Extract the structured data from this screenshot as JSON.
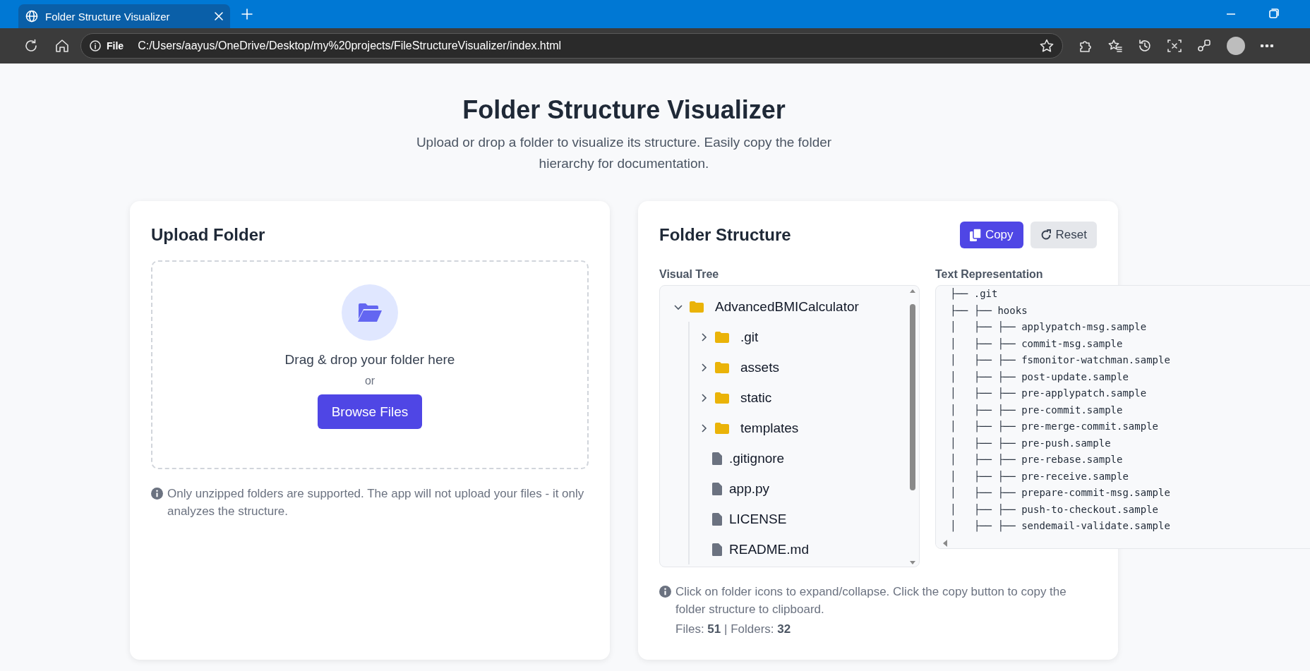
{
  "browser": {
    "tab_title": "Folder Structure Visualizer",
    "scheme_label": "File",
    "url": "C:/Users/aayus/OneDrive/Desktop/my%20projects/FileStructureVisualizer/index.html"
  },
  "header": {
    "title": "Folder Structure Visualizer",
    "subtitle": "Upload or drop a folder to visualize its structure. Easily copy the folder hierarchy for documentation."
  },
  "upload": {
    "title": "Upload Folder",
    "drop_text": "Drag & drop your folder here",
    "or_text": "or",
    "browse_button": "Browse Files",
    "note": "Only unzipped folders are supported. The app will not upload your files - it only analyzes the structure."
  },
  "structure": {
    "title": "Folder Structure",
    "buttons": [
      {
        "label": "Copy",
        "kind": "primary"
      },
      {
        "label": "Reset",
        "kind": "secondary"
      }
    ],
    "visual_tree_label": "Visual Tree",
    "tree": {
      "name": "AdvancedBMICalculator",
      "kind": "folder",
      "expanded": true,
      "children": [
        {
          "name": ".git",
          "kind": "folder",
          "expanded": false
        },
        {
          "name": "assets",
          "kind": "folder",
          "expanded": false
        },
        {
          "name": "static",
          "kind": "folder",
          "expanded": false
        },
        {
          "name": "templates",
          "kind": "folder",
          "expanded": false
        },
        {
          "name": ".gitignore",
          "kind": "file"
        },
        {
          "name": "app.py",
          "kind": "file"
        },
        {
          "name": "LICENSE",
          "kind": "file"
        },
        {
          "name": "README.md",
          "kind": "file"
        }
      ]
    },
    "text_label": "Text Representation",
    "text_lines": [
      "├── .git",
      "├── ├── hooks",
      "│   ├── ├── applypatch-msg.sample",
      "│   ├── ├── commit-msg.sample",
      "│   ├── ├── fsmonitor-watchman.sample",
      "│   ├── ├── post-update.sample",
      "│   ├── ├── pre-applypatch.sample",
      "│   ├── ├── pre-commit.sample",
      "│   ├── ├── pre-merge-commit.sample",
      "│   ├── ├── pre-push.sample",
      "│   ├── ├── pre-rebase.sample",
      "│   ├── ├── pre-receive.sample",
      "│   ├── ├── prepare-commit-msg.sample",
      "│   ├── ├── push-to-checkout.sample",
      "│   ├── ├── sendemail-validate.sample"
    ],
    "help": "Click on folder icons to expand/collapse. Click the copy button to copy the folder structure to clipboard.",
    "stats": "Files: **51** | Folders: **32**"
  }
}
